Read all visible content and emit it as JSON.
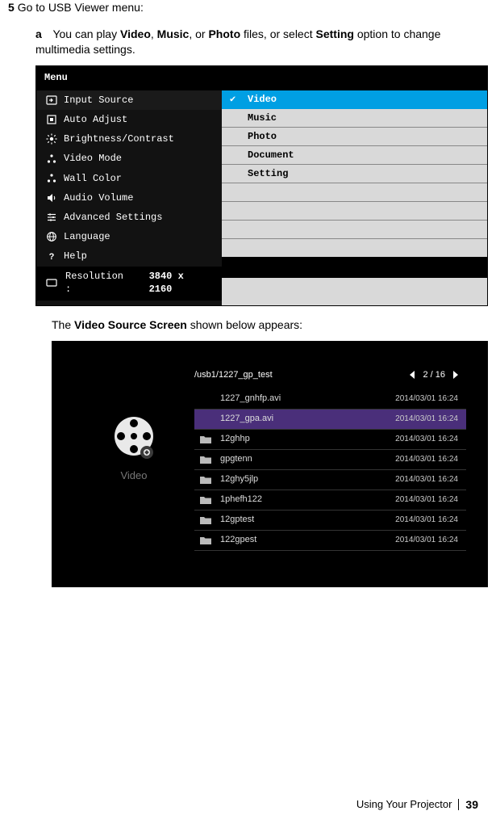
{
  "step": {
    "num": "5",
    "text": "Go to USB Viewer menu:"
  },
  "substep": {
    "letter": "a",
    "pre": "You can play ",
    "b1": "Video",
    "sep1": ", ",
    "b2": "Music",
    "sep2": ", or ",
    "b3": "Photo",
    "mid": " files, or select ",
    "b4": "Setting",
    "post": " option to change multimedia settings."
  },
  "menu": {
    "title": "Menu",
    "left": [
      {
        "label": "Input Source"
      },
      {
        "label": "Auto Adjust"
      },
      {
        "label": "Brightness/Contrast"
      },
      {
        "label": "Video Mode"
      },
      {
        "label": "Wall Color"
      },
      {
        "label": "Audio Volume"
      },
      {
        "label": "Advanced Settings"
      },
      {
        "label": "Language"
      },
      {
        "label": "Help"
      }
    ],
    "right": [
      "Video",
      "Music",
      "Photo",
      "Document",
      "Setting"
    ],
    "res_label": "Resolution :",
    "res_value": "3840 x 2160"
  },
  "midline": {
    "pre": "The ",
    "bold": "Video Source Screen",
    "post": " shown below appears:"
  },
  "video": {
    "path": "/usb1/1227_gp_test",
    "page": "2 / 16",
    "left_label": "Video",
    "rows": [
      {
        "type": "file",
        "name": "1227_gnhfp.avi",
        "date": "2014/03/01  16:24"
      },
      {
        "type": "file",
        "name": "1227_gpa.avi",
        "date": "2014/03/01  16:24",
        "selected": true
      },
      {
        "type": "folder",
        "name": "12ghhp",
        "date": "2014/03/01  16:24"
      },
      {
        "type": "folder",
        "name": "gpgtenn",
        "date": "2014/03/01  16:24"
      },
      {
        "type": "folder",
        "name": "12ghy5jlp",
        "date": "2014/03/01  16:24"
      },
      {
        "type": "folder",
        "name": "1phefh122",
        "date": "2014/03/01  16:24"
      },
      {
        "type": "folder",
        "name": "12gptest",
        "date": "2014/03/01  16:24"
      },
      {
        "type": "folder",
        "name": "122gpest",
        "date": "2014/03/01  16:24"
      }
    ]
  },
  "footer": {
    "section": "Using Your Projector",
    "page": "39"
  }
}
